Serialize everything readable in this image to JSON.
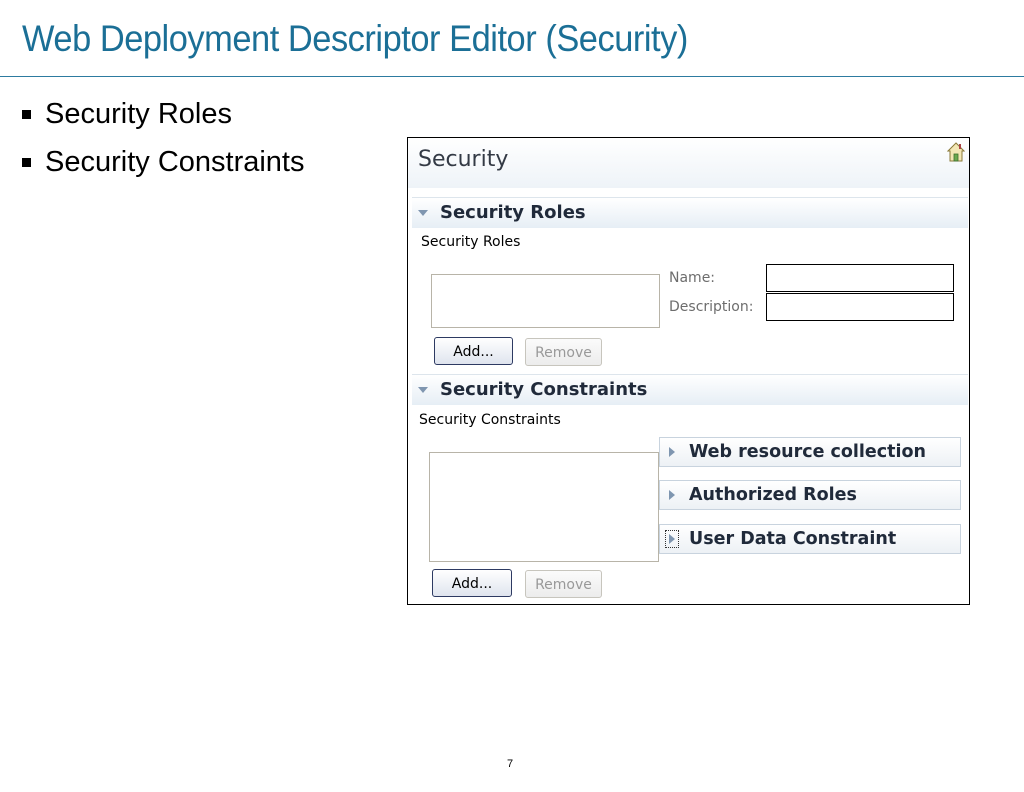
{
  "slide": {
    "title": "Web Deployment Descriptor Editor (Security)",
    "bullets": [
      "Security Roles",
      "Security Constraints"
    ],
    "page_number": "7"
  },
  "editor": {
    "title": "Security",
    "home_icon": "home-icon",
    "roles_section": {
      "header": "Security Roles",
      "list_label": "Security Roles",
      "name_label": "Name:",
      "name_value": "",
      "description_label": "Description:",
      "description_value": "",
      "add_label": "Add...",
      "remove_label": "Remove"
    },
    "constraints_section": {
      "header": "Security Constraints",
      "list_label": "Security Constraints",
      "subsections": [
        "Web resource collection",
        "Authorized Roles",
        "User Data Constraint"
      ],
      "add_label": "Add...",
      "remove_label": "Remove"
    }
  },
  "colors": {
    "title": "#1b6f96",
    "rule": "#2d7ba0",
    "section_header_bg": "#e6eef5"
  }
}
